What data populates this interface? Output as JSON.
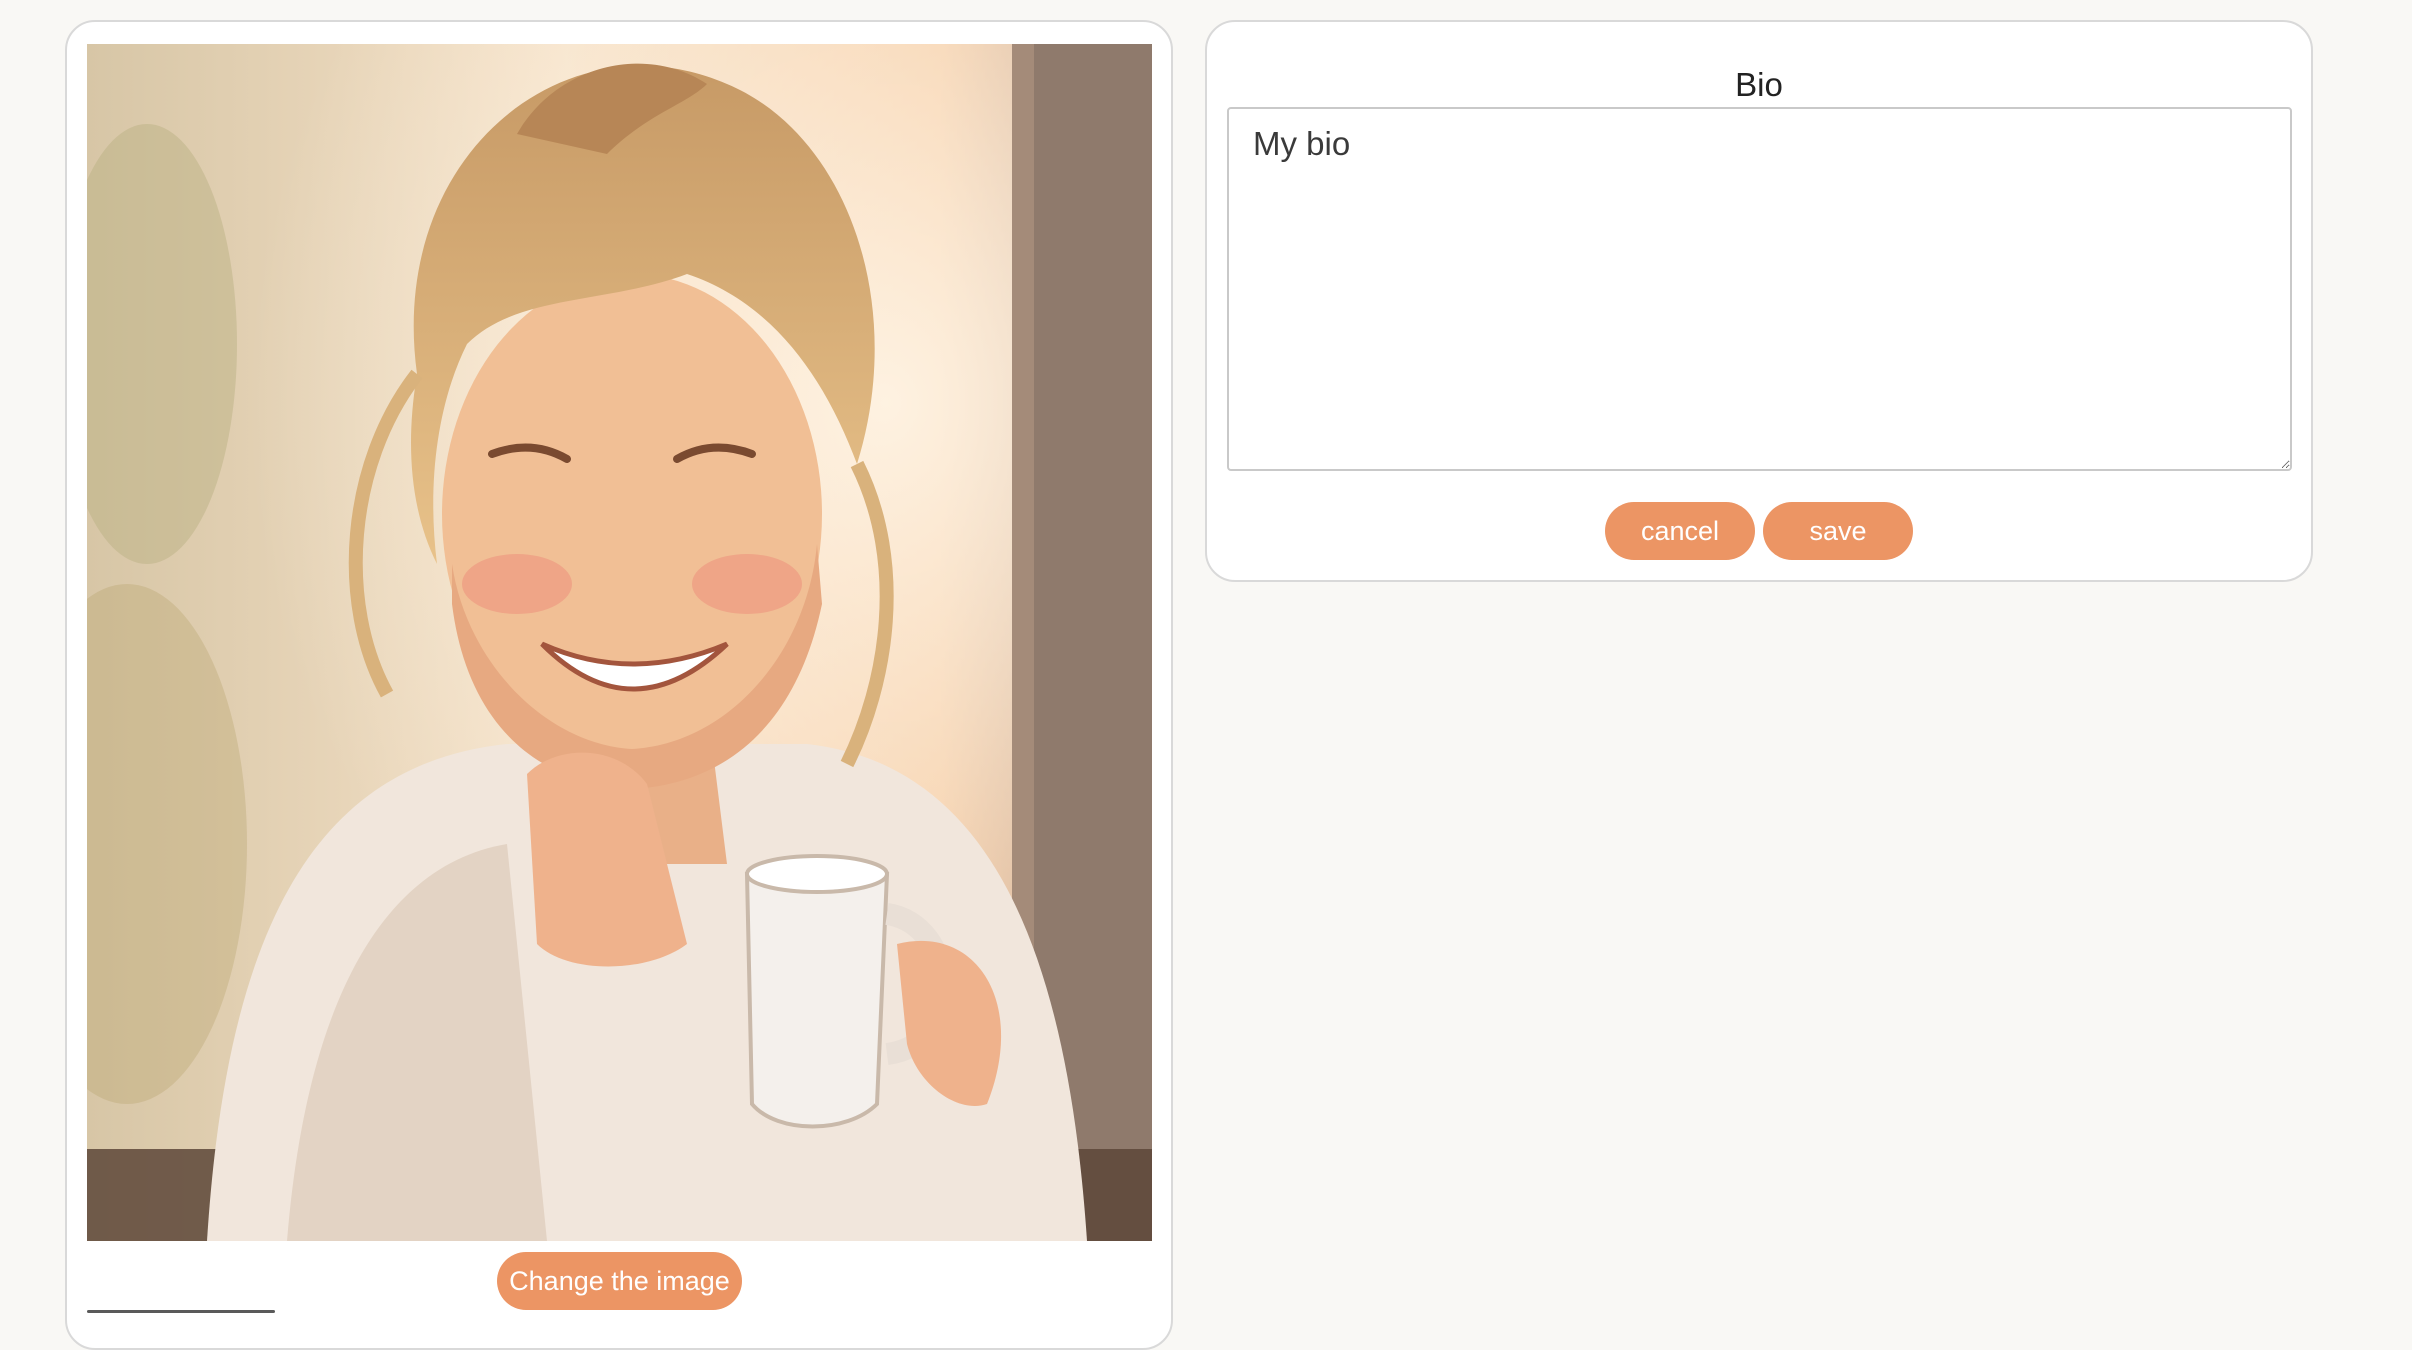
{
  "profile_image": {
    "change_button_label": "Change the image"
  },
  "bio": {
    "title": "Bio",
    "value": "My bio",
    "cancel_label": "cancel",
    "save_label": "save"
  },
  "colors": {
    "accent": "#ec9564",
    "background": "#f9f8f5",
    "card": "#ffffff",
    "border": "#d9d9d9"
  }
}
